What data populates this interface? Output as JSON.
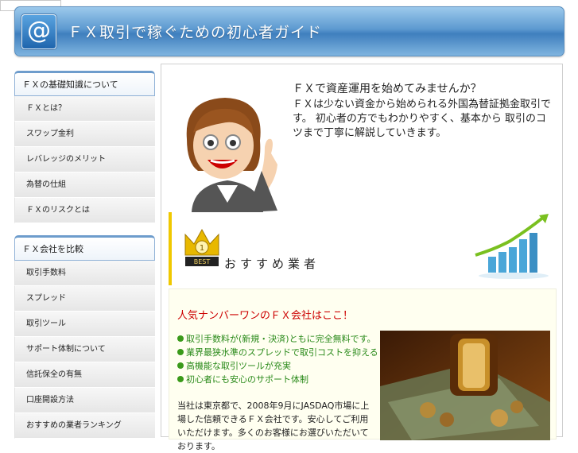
{
  "header": {
    "logo_symbol": "@",
    "site_title": "ＦＸ取引で稼ぐための初心者ガイド"
  },
  "sidebar": {
    "section1": {
      "heading": "ＦＸの基礎知識について",
      "items": [
        {
          "label": "ＦＸとは？"
        },
        {
          "label": "スワップ金利"
        },
        {
          "label": "レバレッジのメリット"
        },
        {
          "label": "為替の仕組"
        },
        {
          "label": "ＦＸのリスクとは"
        }
      ]
    },
    "section2": {
      "heading": "ＦＸ会社を比較",
      "items": [
        {
          "label": "取引手数料"
        },
        {
          "label": "スプレッド"
        },
        {
          "label": "取引ツール"
        },
        {
          "label": "サポート体制について"
        },
        {
          "label": "信託保全の有無"
        },
        {
          "label": "口座開設方法"
        },
        {
          "label": "おすすめの業者ランキング"
        }
      ]
    }
  },
  "intro": {
    "title": "ＦＸで資産運用を始めてみませんか？",
    "text": "ＦＸは少ない資金から始められる外国為替証拠金取引です。 初心者の方でもわかりやすく、基本から 取引のコツまで丁寧に解説していきます。"
  },
  "ranking": {
    "crown_label": "BEST",
    "crown_number": "1",
    "title": "おすすめ業者"
  },
  "panel": {
    "title": "人気ナンバーワンのＦＸ会社はここ！",
    "bullets": [
      "取引手数料が(新規・決済)ともに完全無料です。",
      "業界最狭水準のスプレッドで取引コストを抑える",
      "高機能な取引ツールが充実",
      "初心者にも安心のサポート体制"
    ],
    "body": "当社は東京都で、2008年9月にJASDAQ市場に上場した信頼できるＦＸ会社です。安心してご利用いただけます。多くのお客様にお選びいただいております。"
  },
  "colors": {
    "header_blue": "#3f7fbe",
    "accent_yellow": "#f0c800",
    "panel_title_red": "#cc0000",
    "bullet_green": "#2a8a1a"
  }
}
